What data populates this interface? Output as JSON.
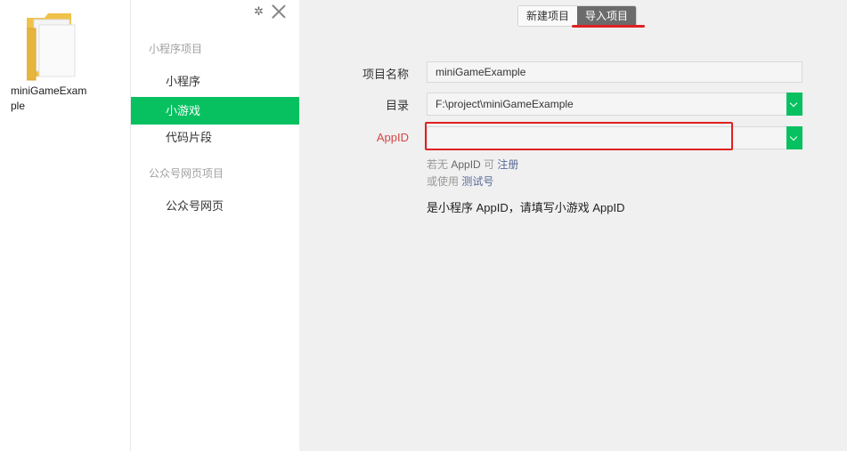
{
  "desktop": {
    "folder_label": "miniGameExample"
  },
  "sidebar": {
    "groups": [
      {
        "title": "小程序项目",
        "items": [
          "小程序",
          "小游戏",
          "代码片段"
        ]
      },
      {
        "title": "公众号网页项目",
        "items": [
          "公众号网页"
        ]
      }
    ],
    "active_item": "小游戏",
    "accent_color": "#07c160"
  },
  "tabs": {
    "new": "新建项目",
    "import": "导入项目",
    "active": "导入项目"
  },
  "form": {
    "name_label": "项目名称",
    "name_value": "miniGameExample",
    "dir_label": "目录",
    "dir_value": "F:\\project\\miniGameExample",
    "appid_label": "AppID",
    "appid_value": "",
    "hint1_prefix": "若无",
    "hint1_appid": "AppID",
    "hint1_mid": "可",
    "hint1_link": "注册",
    "hint2_prefix": "或使用",
    "hint2_link": "测试号",
    "note": "是小程序 AppID，请填写小游戏 AppID"
  },
  "icons": {
    "settings": "gear-icon",
    "close": "close-icon",
    "dropdown": "chevron-down-icon",
    "folder": "folder-icon"
  }
}
